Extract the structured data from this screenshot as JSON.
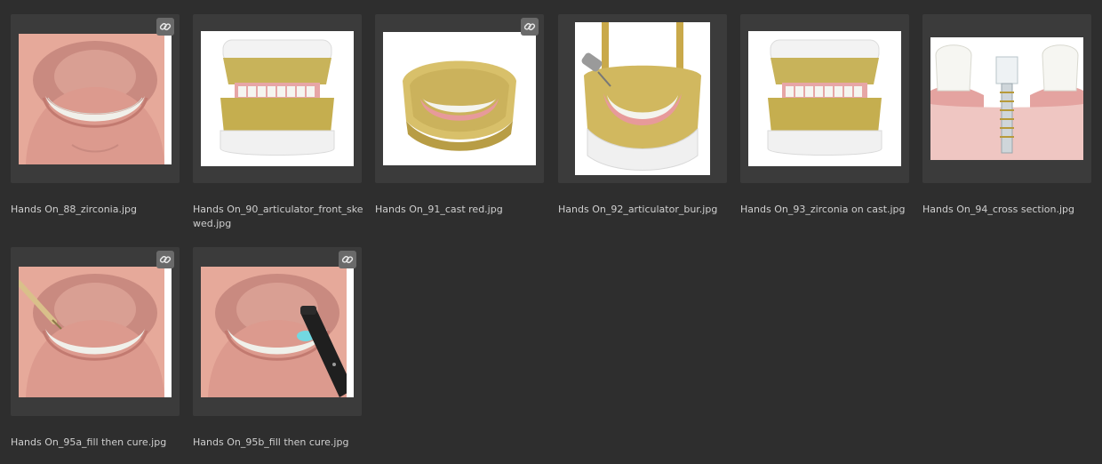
{
  "assets": [
    {
      "filename": "Hands On_88_zirconia.jpg",
      "linked": true,
      "thumbnail": "mouth-lower-arch"
    },
    {
      "filename": "Hands On_90_articulator_front_skewed.jpg",
      "linked": false,
      "thumbnail": "articulator-front"
    },
    {
      "filename": "Hands On_91_cast red.jpg",
      "linked": true,
      "thumbnail": "cast-model"
    },
    {
      "filename": "Hands On_92_articulator_bur.jpg",
      "linked": false,
      "thumbnail": "articulator-with-bur"
    },
    {
      "filename": "Hands On_93_zirconia on cast.jpg",
      "linked": false,
      "thumbnail": "articulator-front"
    },
    {
      "filename": "Hands On_94_cross section.jpg",
      "linked": false,
      "thumbnail": "implant-cross-section"
    },
    {
      "filename": "Hands On_95a_fill then cure.jpg",
      "linked": true,
      "thumbnail": "mouth-with-syringe"
    },
    {
      "filename": "Hands On_95b_fill then cure.jpg",
      "linked": true,
      "thumbnail": "mouth-with-curing-light"
    }
  ],
  "icons": {
    "link_badge": "link-icon"
  },
  "colors": {
    "background": "#2e2e2e",
    "tile": "#3b3b3b",
    "caption_text": "#cfcfcf",
    "link_badge": "#6a6a6a"
  }
}
